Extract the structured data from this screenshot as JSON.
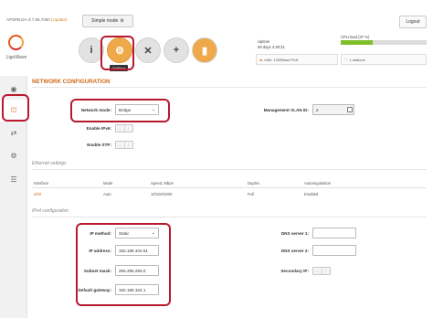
{
  "topbar": {
    "firmware": "APSPB.DA-3.7.95.7050",
    "firmware_update": "(Update)",
    "mode_label": "Simple mode",
    "logout_label": "Logout"
  },
  "brand": {
    "name": "LigoWave"
  },
  "toolbar": {
    "items": [
      {
        "name": "info",
        "glyph": "i"
      },
      {
        "name": "settings",
        "glyph": "⚙"
      },
      {
        "name": "tools",
        "glyph": "✕"
      },
      {
        "name": "medical",
        "glyph": "+"
      },
      {
        "name": "battery",
        "glyph": "▮"
      }
    ],
    "tooltip": "Settings"
  },
  "status": {
    "options_label": "Uptime",
    "uptime": "59 days 4:30:31",
    "cpu_label": "CPU load (37 %)",
    "cpu_percent": 37,
    "eth_label": "eth0: 1000BaseTFull",
    "stations_label": "1 stations"
  },
  "sidenav": {
    "items": [
      {
        "name": "wireless",
        "glyph": "◉"
      },
      {
        "name": "network",
        "glyph": "⛫"
      },
      {
        "name": "routing",
        "glyph": "⇄"
      },
      {
        "name": "services",
        "glyph": "⚙"
      },
      {
        "name": "system",
        "glyph": "☰"
      }
    ]
  },
  "main": {
    "title": "NETWORK CONFIGURATION",
    "network_mode_label": "Network mode:",
    "network_mode_value": "Bridge",
    "mgmt_vlan_label": "Management VLAN ID:",
    "mgmt_vlan_value": "2",
    "ipv6_label": "Enable IPv6:",
    "stp_label": "Enable STP:",
    "toggle_off": "—",
    "toggle_on": "l",
    "ethernet_section": "Ethernet settings",
    "table": {
      "headers": [
        "Interface",
        "Mode",
        "Speed, Mbps",
        "Duplex",
        "Autonegotiation"
      ],
      "rows": [
        [
          "eth0",
          "Auto",
          "10/100/1000",
          "Full",
          "Enabled"
        ]
      ]
    },
    "ipv4_section": "IPv4 configuration",
    "ip_method_label": "IP method:",
    "ip_method_value": "Static",
    "ip_address_label": "IP address:",
    "ip_address_value": "192.168.104.61",
    "subnet_mask_label": "Subnet mask:",
    "subnet_mask_value": "255.255.255.0",
    "gateway_label": "Default gateway:",
    "gateway_value": "192.168.104.1",
    "dns1_label": "DNS server 1:",
    "dns2_label": "DNS server 2:",
    "secondary_ip_label": "Secondary IP:"
  },
  "colors": {
    "accent": "#d06a1a",
    "highlight": "#b8192e",
    "cpu_bar": "#7fbf2a",
    "active_icon": "#f0a94a"
  }
}
